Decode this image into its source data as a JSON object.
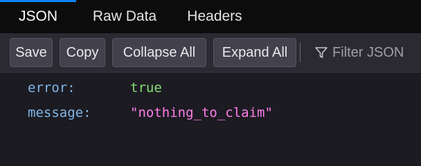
{
  "tabs": [
    {
      "label": "JSON",
      "active": true
    },
    {
      "label": "Raw Data",
      "active": false
    },
    {
      "label": "Headers",
      "active": false
    }
  ],
  "toolbar": {
    "save_label": "Save",
    "copy_label": "Copy",
    "collapse_label": "Collapse All",
    "expand_label": "Expand All",
    "filter_placeholder": "Filter JSON",
    "filter_icon": "funnel-icon"
  },
  "json": {
    "rows": [
      {
        "key": "error:",
        "value": "true",
        "type": "boolean"
      },
      {
        "key": "message:",
        "value": "\"nothing_to_claim\"",
        "type": "string"
      }
    ]
  },
  "colors": {
    "active_tab_accent": "#0a84ff",
    "key": "#7fb6e9",
    "boolean": "#86de74",
    "string": "#ff7de9"
  }
}
